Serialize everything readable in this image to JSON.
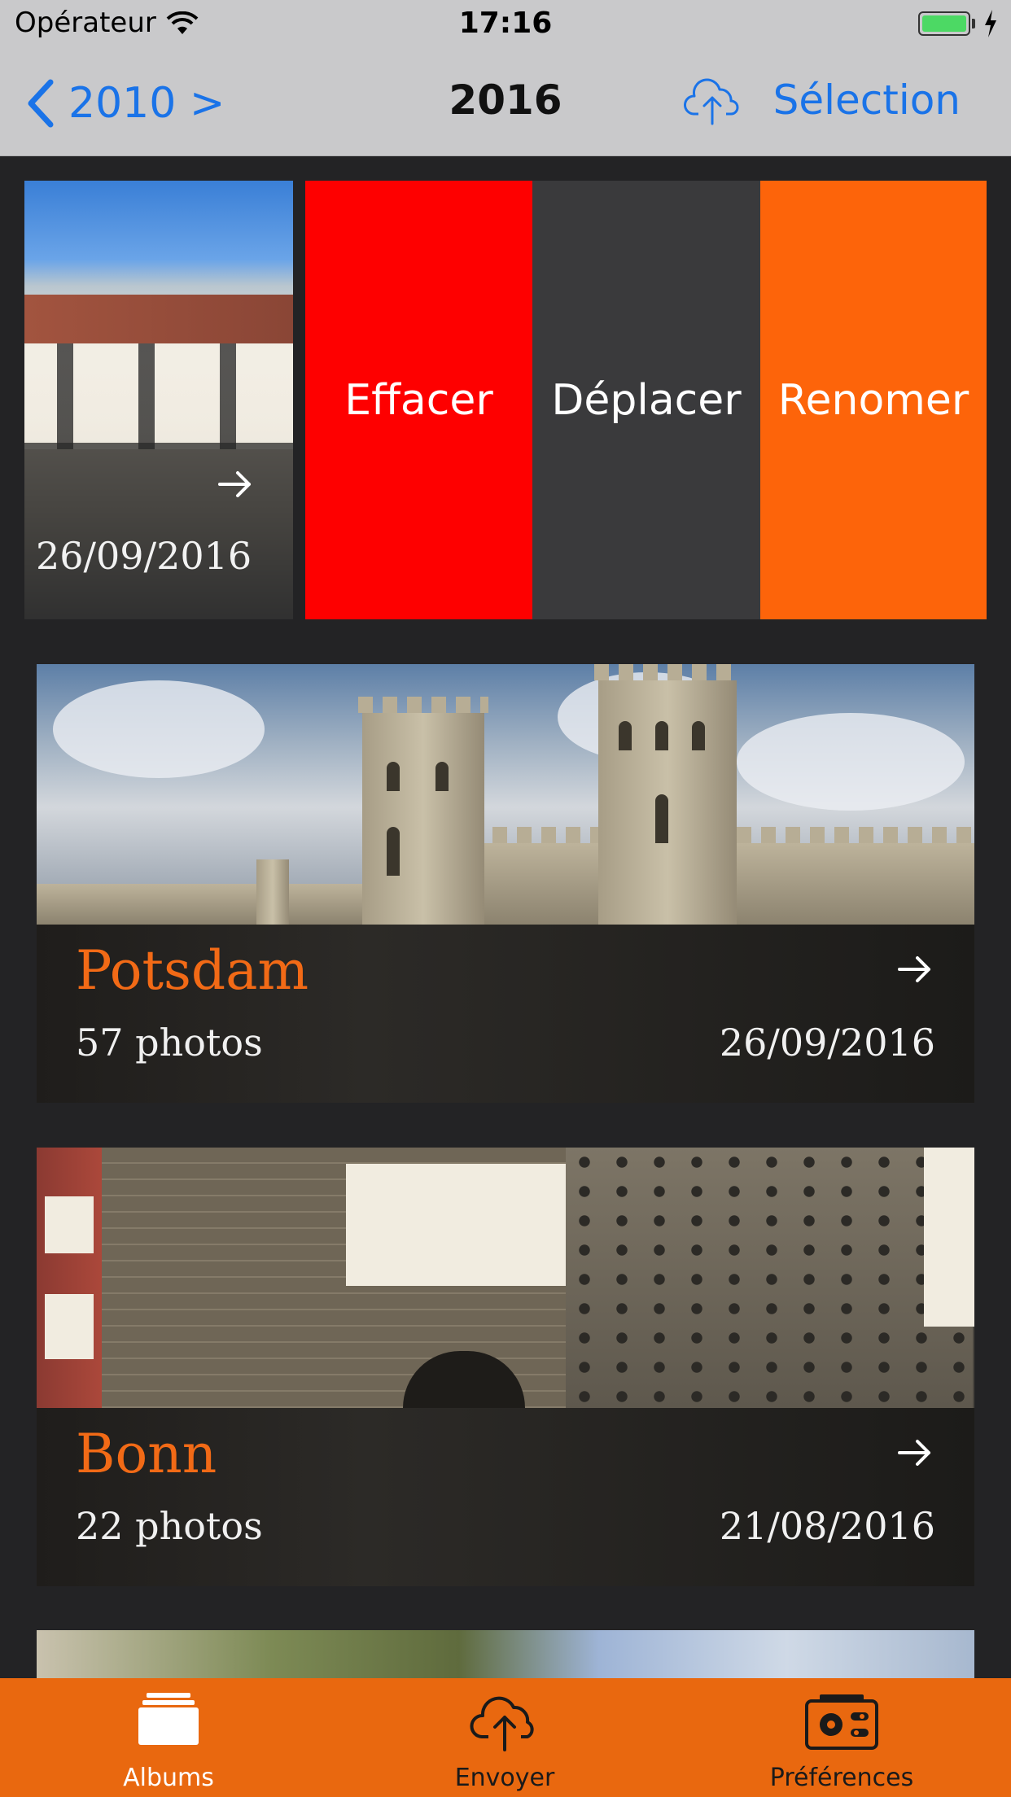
{
  "status_bar": {
    "carrier": "Opérateur",
    "time": "17:16",
    "battery_level": 1.0,
    "battery_color": "#4cd964"
  },
  "nav": {
    "back_label": "2010 >",
    "title": "2016",
    "select_label": "Sélection",
    "cloud_icon": "cloud-upload-icon",
    "accent": "#1a73e8"
  },
  "swipe_row": {
    "date": "26/09/2016",
    "actions": [
      {
        "label": "Effacer",
        "color": "#fe0000"
      },
      {
        "label": "Déplacer",
        "color": "#3a3a3c"
      },
      {
        "label": "Renomer",
        "color": "#fd640a"
      }
    ]
  },
  "albums": [
    {
      "title": "Potsdam",
      "count": "57 photos",
      "date": "26/09/2016"
    },
    {
      "title": "Bonn",
      "count": "22 photos",
      "date": "21/08/2016"
    }
  ],
  "tabbar": {
    "color": "#e9680f",
    "tabs": [
      {
        "label": "Albums",
        "icon": "albums-icon",
        "selected": true
      },
      {
        "label": "Envoyer",
        "icon": "cloud-upload-icon",
        "selected": false
      },
      {
        "label": "Préférences",
        "icon": "settings-camera-icon",
        "selected": false
      }
    ]
  }
}
